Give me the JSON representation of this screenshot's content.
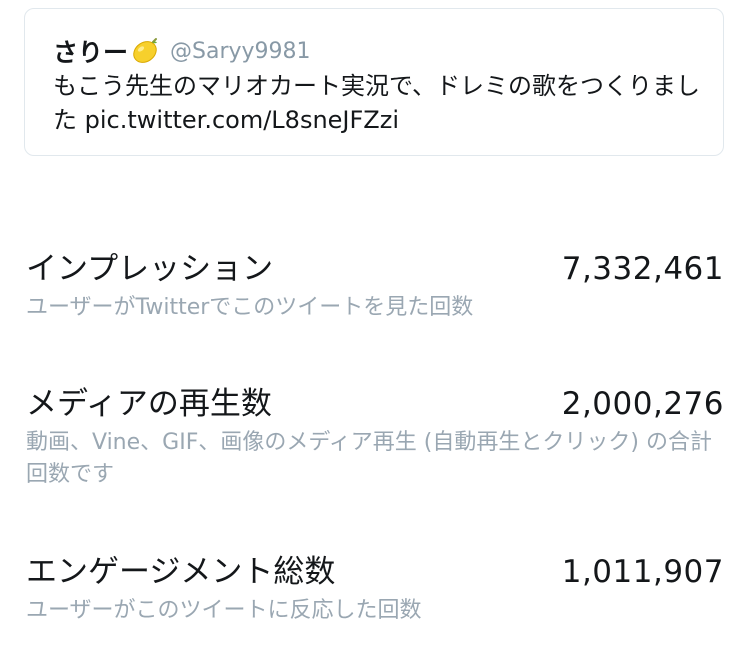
{
  "tweet": {
    "author_name": "さりー",
    "author_emoji_icon": "lemon-icon",
    "author_handle": "@Saryy9981",
    "text": "もこう先生のマリオカート実況で、ドレミの歌をつくりました ",
    "link": "pic.twitter.com/L8sneJFZzi"
  },
  "stats": {
    "impressions": {
      "label": "インプレッション",
      "value": "7,332,461",
      "description": "ユーザーがTwitterでこのツイートを見た回数"
    },
    "media_views": {
      "label": "メディアの再生数",
      "value": "2,000,276",
      "description": "動画、Vine、GIF、画像のメディア再生 (自動再生とクリック) の合計回数です"
    },
    "engagements": {
      "label": "エンゲージメント総数",
      "value": "1,011,907",
      "description": "ユーザーがこのツイートに反応した回数"
    }
  },
  "colors": {
    "text_primary": "#14171a",
    "text_secondary": "#9aa7b2",
    "handle": "#8899a6",
    "card_border": "#e1e8ed",
    "lemon": "#f7d02c"
  }
}
